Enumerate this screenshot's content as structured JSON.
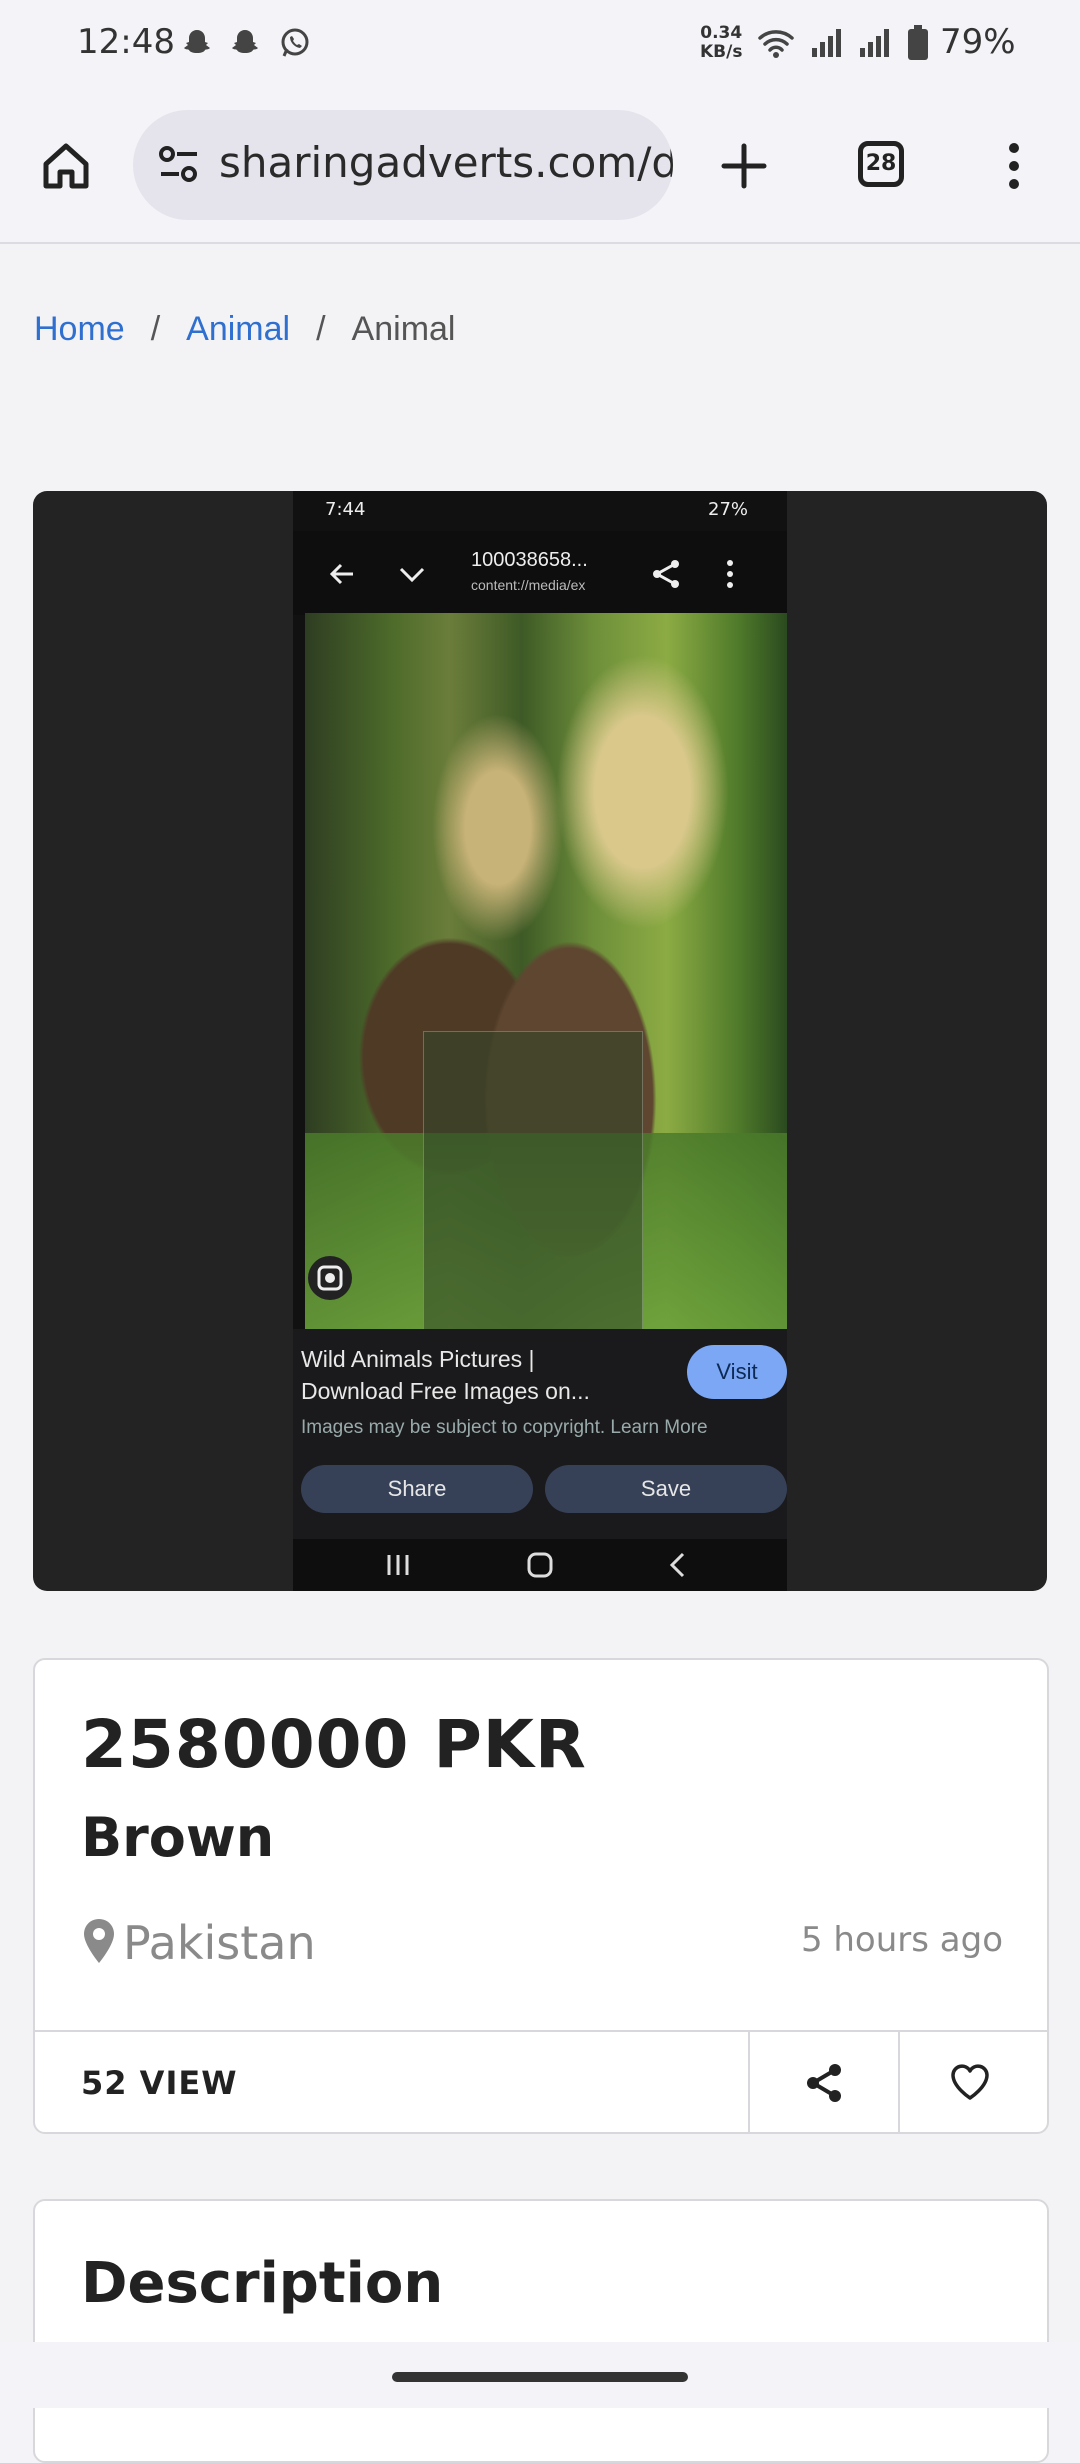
{
  "status_bar": {
    "time": "12:48",
    "net_speed_value": "0.34",
    "net_speed_unit": "KB/s",
    "battery": "79%"
  },
  "browser": {
    "url": "sharingadverts.com/d",
    "tab_count": "28"
  },
  "breadcrumb": {
    "items": [
      "Home",
      "Animal",
      "Animal"
    ]
  },
  "embedded_screenshot": {
    "time": "7:44",
    "battery": "27%",
    "file_name": "100038658...",
    "file_path": "content://media/ex",
    "title_line1": "Wild Animals Pictures |",
    "title_line2": "Download Free Images on...",
    "subtitle": "Images may be subject to copyright. Learn More",
    "visit_label": "Visit",
    "share_label": "Share",
    "save_label": "Save"
  },
  "listing": {
    "price": "2580000 PKR",
    "title": "Brown",
    "location": "Pakistan",
    "posted": "5 hours ago",
    "views": "52 VIEW"
  },
  "description": {
    "heading": "Description"
  },
  "colors": {
    "link": "#2f6fcf",
    "panel": "#232323",
    "card_border": "#d8d8dc"
  }
}
